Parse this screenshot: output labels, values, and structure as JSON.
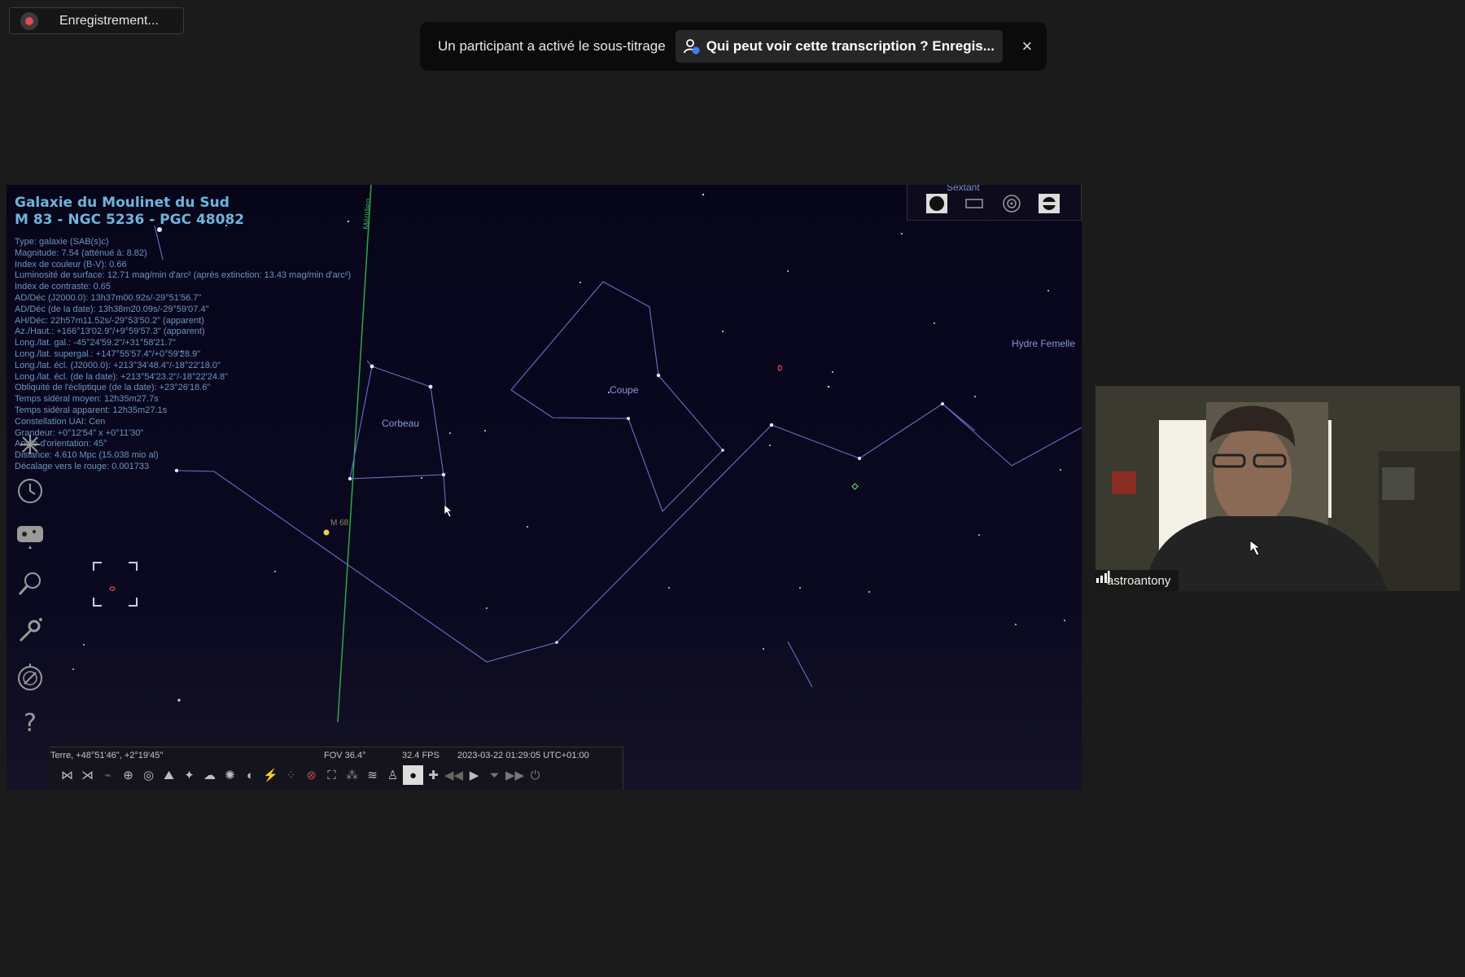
{
  "recording": {
    "label": "Enregistrement..."
  },
  "banner": {
    "text": "Un participant a activé le sous-titrage",
    "button_label": "Qui peut voir cette transcription ? Enregis...",
    "close": "×"
  },
  "stellarium": {
    "object_title_line1": "Galaxie du Moulinet du Sud",
    "object_title_line2": "M 83 - NGC 5236 - PGC 48082",
    "info_lines": [
      "Type: galaxie (SAB(s)c)",
      "Magnitude: 7.54 (atténué à: 8.82)",
      "Index de couleur (B-V): 0.66",
      "Luminosité de surface: 12.71 mag/min d'arc² (après extinction: 13.43 mag/min d'arc²)",
      "Index de contraste: 0.65",
      "AD/Déc (J2000.0): 13h37m00.92s/-29°51'56.7\"",
      "AD/Déc (de la date): 13h38m20.09s/-29°59'07.4\"",
      "AH/Déc: 22h57m11.52s/-29°53'50.2\" (apparent)",
      "Az./Haut.: +166°13'02.9\"/+9°59'57.3\" (apparent)",
      "Long./lat. gal.: -45°24'59.2\"/+31°58'21.7\"",
      "Long./lat. supergal.: +147°55'57.4\"/+0°59'28.9\"",
      "Long./lat. écl. (J2000.0): +213°34'48.4\"/-18°22'18.0\"",
      "Long./lat. écl. (de la date): +213°54'23.2\"/-18°22'24.8\"",
      "Obliquité de l'écliptique (de la date): +23°26'18.6\"",
      "Temps sidéral moyen: 12h35m27.7s",
      "Temps sidéral apparent: 12h35m27.1s",
      "Constellation UAI: Cen",
      "Grandeur: +0°12'54\" x +0°11'30\"",
      "Angle d'orientation: 45°",
      "Distance: 4.610 Mpc (15.038 mio al)",
      "Décalage vers le rouge: 0.001733"
    ],
    "labels": {
      "meridian": "Méridien",
      "corbeau": "Corbeau",
      "coupe": "Coupe",
      "hydre": "Hydre Femelle",
      "m68": "M 68",
      "sextant": "Sextant"
    },
    "status": {
      "location": "Terre, +48°51'46\", +2°19'45\"",
      "fov": "FOV 36.4°",
      "fps": "32.4 FPS",
      "datetime": "2023-03-22 01:29:05 UTC+01:00"
    },
    "sidebar_icons": [
      "location-icon",
      "clock-icon",
      "sky-view-icon",
      "search-icon",
      "settings-icon",
      "astro-calc-icon",
      "help-icon"
    ]
  },
  "video": {
    "participant_name": "astroantony"
  }
}
